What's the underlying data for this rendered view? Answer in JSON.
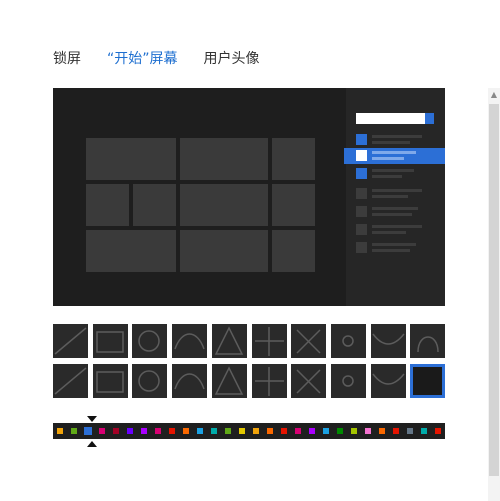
{
  "tabs": [
    {
      "label": "锁屏",
      "active": false
    },
    {
      "label": "“开始”屏幕",
      "active": true
    },
    {
      "label": "用户头像",
      "active": false
    }
  ],
  "colors": {
    "accent": "#1e6fd0",
    "preview_background": "#1e1e1e",
    "tile": "#3a3a3a"
  },
  "patterns": [
    "pattern-1",
    "pattern-2",
    "pattern-3",
    "pattern-4",
    "pattern-5",
    "pattern-6",
    "pattern-7",
    "pattern-8",
    "pattern-9",
    "pattern-10",
    "pattern-11",
    "pattern-12",
    "pattern-13",
    "pattern-14",
    "pattern-15",
    "pattern-16",
    "pattern-17",
    "pattern-18",
    "pattern-19",
    "pattern-20"
  ],
  "selected_pattern_index": 19,
  "color_swatches": [
    "#f0a30a",
    "#60a917",
    "#2c6fd6",
    "#d80073",
    "#a20025",
    "#6a00ff",
    "#aa00ff",
    "#d80073",
    "#e51400",
    "#fa6800",
    "#1ba1e2",
    "#00aba9",
    "#60a917",
    "#e3c800",
    "#f0a30a",
    "#fa6800",
    "#e51400",
    "#d80073",
    "#aa00ff",
    "#1ba1e2",
    "#008a00",
    "#a4c400",
    "#f472d0",
    "#fa6800",
    "#e51400",
    "#647687",
    "#00aba9",
    "#e51400"
  ],
  "selected_color_index": 2
}
